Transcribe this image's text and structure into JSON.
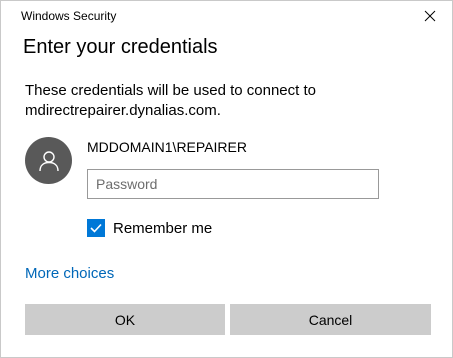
{
  "window": {
    "title": "Windows Security",
    "close_icon": "close-icon"
  },
  "dialog": {
    "heading": "Enter your credentials",
    "description_line1": "These credentials will be used to connect to",
    "description_line2": "mdirectrepairer.dynalias.com."
  },
  "account": {
    "avatar_icon": "user-icon",
    "username": "MDDOMAIN1\\REPAIRER"
  },
  "password": {
    "value": "",
    "placeholder": "Password"
  },
  "remember": {
    "label": "Remember me",
    "checked": true
  },
  "links": {
    "more_choices": "More choices"
  },
  "buttons": {
    "ok": "OK",
    "cancel": "Cancel"
  },
  "colors": {
    "accent": "#0078d7",
    "link": "#0067b8",
    "avatar_bg": "#595959",
    "button_bg": "#cccccc"
  }
}
